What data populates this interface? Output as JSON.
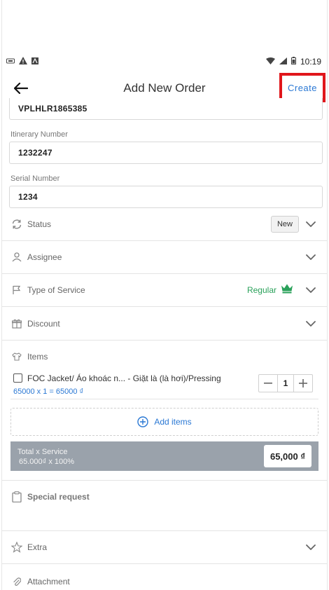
{
  "status_bar": {
    "time": "10:19",
    "left_icons": [
      "app-icon",
      "warning-icon",
      "text-icon"
    ],
    "right_icons": [
      "wifi-icon",
      "signal-icon",
      "battery-icon"
    ]
  },
  "header": {
    "title": "Add New Order",
    "create_label": "Create"
  },
  "fields": {
    "order_code": "VPLHLR1865385",
    "itinerary_label": "Itinerary Number",
    "itinerary_value": "1232247",
    "serial_label": "Serial Number",
    "serial_value": "1234"
  },
  "rows": {
    "status_label": "Status",
    "status_value": "New",
    "assignee_label": "Assignee",
    "service_label": "Type of Service",
    "service_value": "Regular",
    "discount_label": "Discount",
    "items_label": "Items",
    "special_label": "Special request",
    "extra_label": "Extra",
    "attachment_label": "Attachment"
  },
  "items": [
    {
      "name": "FOC  Jacket/ Áo khoác n... - Giặt là (là hơi)/Pressing",
      "calc": "65000 x 1 = 65000 ₫",
      "quantity": "1"
    }
  ],
  "add_items_label": "Add items",
  "total": {
    "line1": "Total x Service",
    "line2": "65.000₫ x 100%",
    "amount": "65,000 ₫"
  },
  "colors": {
    "accent": "#2a78d4",
    "highlight": "#e0161b",
    "regular": "#2aa15a",
    "total_bar": "#9aa2ab"
  }
}
